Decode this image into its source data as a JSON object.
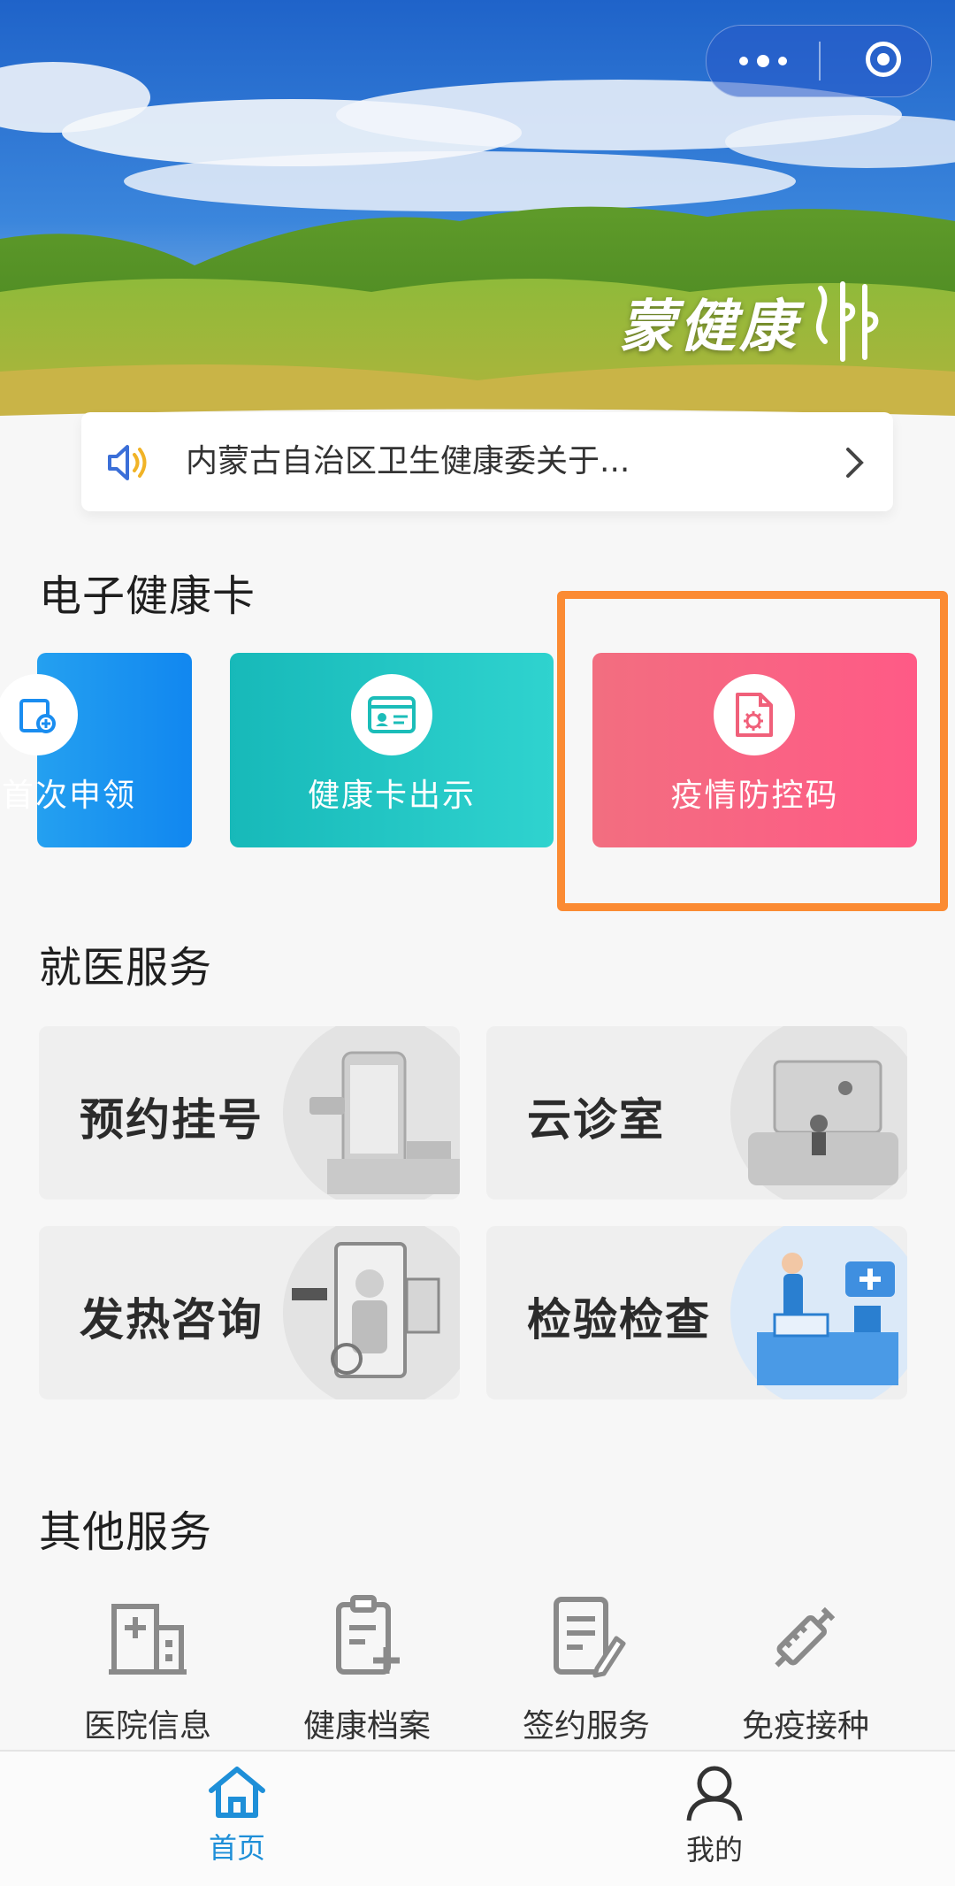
{
  "notice": {
    "text": "内蒙古自治区卫生健康委关于..."
  },
  "brand": {
    "name": "蒙健康"
  },
  "health_card": {
    "title": "电子健康卡",
    "tiles": [
      {
        "label": "首次申领",
        "visible_label": "首次申领"
      },
      {
        "label": "健康卡出示"
      },
      {
        "label": "疫情防控码"
      }
    ]
  },
  "medical": {
    "title": "就医服务",
    "items": [
      {
        "label": "预约挂号"
      },
      {
        "label": "云诊室"
      },
      {
        "label": "发热咨询"
      },
      {
        "label": "检验检查"
      }
    ]
  },
  "other": {
    "title": "其他服务",
    "items": [
      {
        "label": "医院信息",
        "icon": "hospital-icon"
      },
      {
        "label": "健康档案",
        "icon": "health-record-icon"
      },
      {
        "label": "签约服务",
        "icon": "contract-icon"
      },
      {
        "label": "免疫接种",
        "icon": "vaccine-icon"
      }
    ]
  },
  "nav": {
    "home": {
      "label": "首页",
      "icon": "home-icon"
    },
    "me": {
      "label": "我的",
      "icon": "user-icon"
    }
  },
  "colors": {
    "accent": "#1e8fd8",
    "highlight": "#fb8b33",
    "tile_blue": "#1187f0",
    "tile_teal": "#2fd3cf",
    "tile_pink": "#ff5a86"
  }
}
